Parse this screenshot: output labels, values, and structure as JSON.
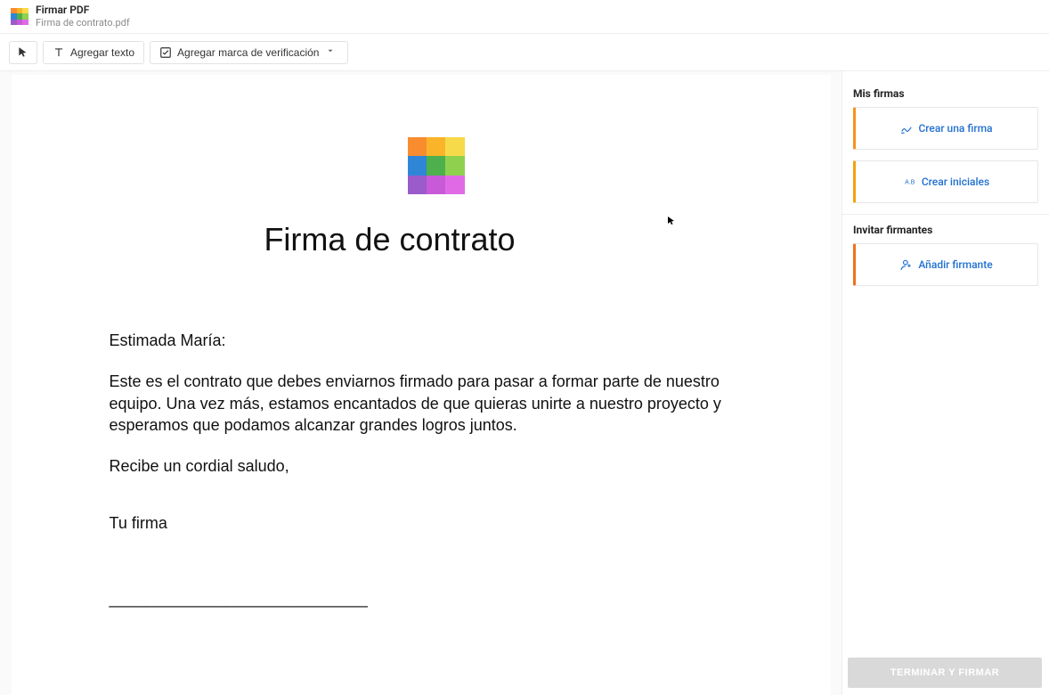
{
  "header": {
    "app_title": "Firmar PDF",
    "file_name": "Firma de contrato.pdf"
  },
  "toolbar": {
    "select_tool": "Seleccionar",
    "add_text": "Agregar texto",
    "add_checkmark": "Agregar marca de verificación"
  },
  "document": {
    "heading": "Firma de contrato",
    "salutation": "Estimada María:",
    "body_paragraph": "Este es el contrato que debes enviarnos firmado para pasar a formar parte de nuestro equipo. Una vez más, estamos encantados de que quieras unirte a nuestro proyecto y esperamos que podamos alcanzar grandes logros juntos.",
    "closing": "Recibe un cordial saludo,",
    "signature_label": "Tu firma",
    "signature_line": "_____________________________"
  },
  "sidebar": {
    "my_signatures_title": "Mis firmas",
    "create_signature": "Crear una firma",
    "create_initials": "Crear iniciales",
    "invite_signers_title": "Invitar firmantes",
    "add_signer": "Añadir firmante"
  },
  "footer": {
    "finish_button": "TERMINAR Y FIRMAR"
  },
  "colors": {
    "link_blue": "#1f6fd0",
    "accent_orange": "#f7921e",
    "accent_amber": "#f2a20c"
  }
}
